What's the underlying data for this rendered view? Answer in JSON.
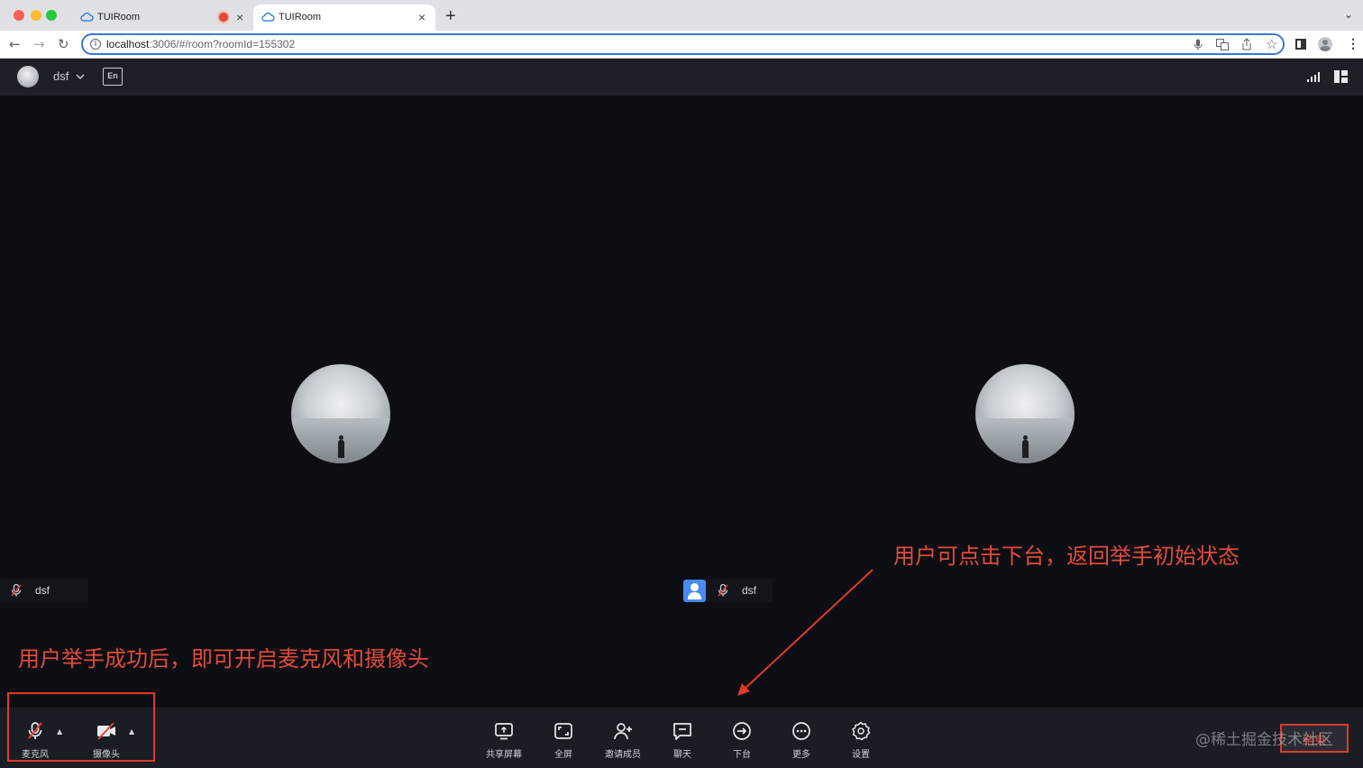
{
  "browser": {
    "tabs": [
      {
        "title": "TUIRoom",
        "recording": true
      },
      {
        "title": "TUIRoom",
        "active": true
      }
    ],
    "url_host": "localhost",
    "url_rest": ":3006/#/room?roomId=155302",
    "new_tab_icon": "plus-icon"
  },
  "header": {
    "user_name": "dsf",
    "language_icon": "translate-icon"
  },
  "stage": {
    "left_participant": {
      "name": "dsf",
      "mic_muted": true
    },
    "right_participant": {
      "name": "dsf",
      "mic_muted": true
    }
  },
  "toolbar": {
    "mic_label": "麦克风",
    "camera_label": "摄像头",
    "share_label": "共享屏幕",
    "fullscreen_label": "全屏",
    "invite_label": "邀请成员",
    "chat_label": "聊天",
    "leave_stage_label": "下台",
    "more_label": "更多",
    "settings_label": "设置",
    "end_label": "结束"
  },
  "annotations": {
    "top_right": "用户可点击下台，返回举手初始状态",
    "bottom_left": "用户举手成功后，即可开启麦克风和摄像头"
  },
  "watermark": "@稀土掘金技术社区",
  "colors": {
    "annotation": "#e24b3b",
    "accent_blue": "#3b76d9",
    "background": "#0d0e14"
  }
}
